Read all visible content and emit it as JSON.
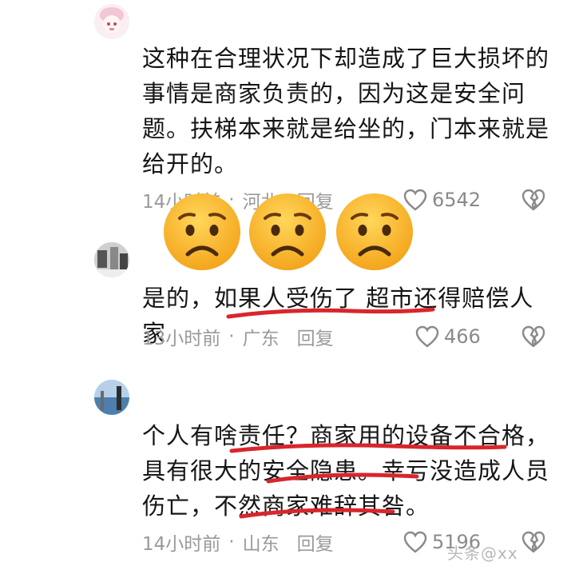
{
  "comments": [
    {
      "text_lines": [
        "这种在合理状况下却造成了巨大损坏的",
        "事情是商家负责的，因为这是安全问",
        "题。扶梯本来就是给坐的，门本来就是",
        "给开的。"
      ],
      "time": "14小时前",
      "location": "河北",
      "reply_label": "回复",
      "likes": "6542"
    },
    {
      "text_lines": [
        "是的，如果人受伤了 超市还得赔偿人家"
      ],
      "time": "13小时前",
      "location": "广东",
      "reply_label": "回复",
      "likes": "466"
    },
    {
      "text_lines": [
        "个人有啥责任？商家用的设备不合格，",
        "具有很大的安全隐患。幸亏没造成人员",
        "伤亡，不然商家难辞其咎。"
      ],
      "time": "14小时前",
      "location": "山东",
      "reply_label": "回复",
      "likes": "5196"
    }
  ],
  "emojis": [
    "disappointed-face",
    "disappointed-face",
    "disappointed-face"
  ],
  "watermark": "头条@xx",
  "colors": {
    "underline": "#d8262c",
    "meta": "#9a9a9a",
    "emoji": "#f7b32b"
  }
}
